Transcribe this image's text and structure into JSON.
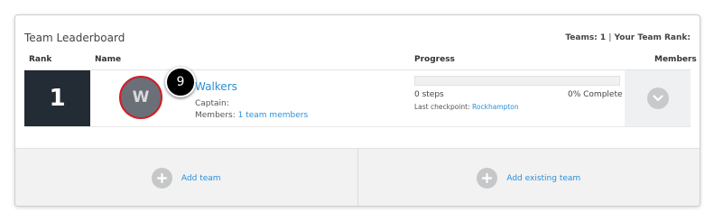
{
  "leaderboard": {
    "title": "Team Leaderboard",
    "teams_label": "Teams: 1",
    "separator": "|",
    "rank_label": "Your Team Rank:"
  },
  "columns": {
    "rank": "Rank",
    "name": "Name",
    "progress": "Progress",
    "members": "Members"
  },
  "team": {
    "rank": "1",
    "avatar_initial": "W",
    "step_badge": "9",
    "name": "Walkers",
    "captain_label": "Captain:",
    "members_label": "Members:",
    "members_link": "1 team members",
    "steps": "0 steps",
    "percent_complete": "0% Complete",
    "progress_fraction": 0,
    "checkpoint_label": "Last checkpoint:",
    "checkpoint_link": "Rockhampton",
    "expand_icon": "chevron-down-icon"
  },
  "actions": {
    "add_team": "Add team",
    "add_existing_team": "Add existing team",
    "icon": "plus-icon"
  },
  "colors": {
    "accent": "#2b8fd6",
    "rank_bg": "#232b34",
    "avatar_border": "#d21d24",
    "avatar_bg": "#6a6f78"
  }
}
